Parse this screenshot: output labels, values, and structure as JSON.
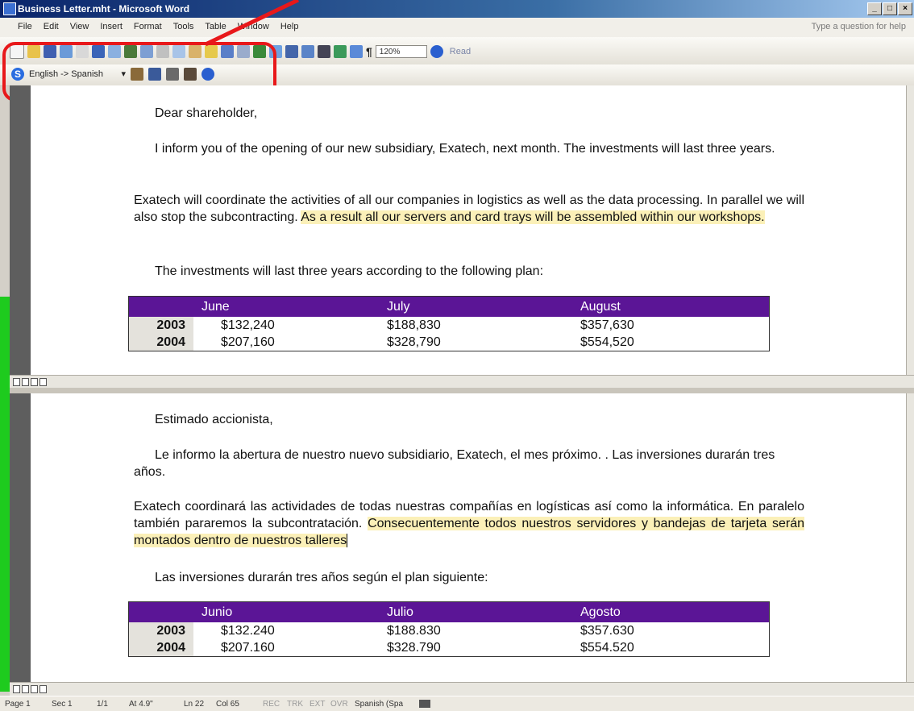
{
  "window": {
    "title": "Business Letter.mht - Microsoft Word"
  },
  "menu": {
    "items": [
      "File",
      "Edit",
      "View",
      "Insert",
      "Format",
      "Tools",
      "Table",
      "Window",
      "Help"
    ],
    "help_placeholder": "Type a question for help"
  },
  "toolbar": {
    "zoom": "120%",
    "read_label": "Read"
  },
  "translate_bar": {
    "direction": "English -> Spanish"
  },
  "english": {
    "greeting": "Dear shareholder,",
    "p1": "I inform you of the opening of our new subsidiary, Exatech, next month. The investments will last three years.",
    "p2_start": "Exatech will coordinate the activities of all our companies in logistics as well as the data processing. In parallel we will also stop the subcontracting. ",
    "p2_highlight": "As a result all our servers and card trays will be assembled within our workshops.",
    "p3": "The investments will last three years according to the following plan:",
    "table": {
      "headers": [
        "June",
        "July",
        "August"
      ],
      "rows": [
        {
          "year": "2003",
          "values": [
            "$132,240",
            "$188,830",
            "$357,630"
          ]
        },
        {
          "year": "2004",
          "values": [
            "$207,160",
            "$328,790",
            "$554,520"
          ]
        }
      ]
    }
  },
  "spanish": {
    "greeting": "Estimado accionista,",
    "p1": "Le informo la abertura de nuestro nuevo subsidiario, Exatech, el mes próximo. . Las inversiones durarán tres años.",
    "p2_start": "Exatech coordinará las actividades de todas nuestras compañías en logísticas así como la informática. En paralelo también pararemos la subcontratación. ",
    "p2_highlight": "Consecuentemente todos nuestros servidores y bandejas de tarjeta serán montados dentro de nuestros talleres",
    "p3": "Las inversiones durarán tres años según el plan siguiente:",
    "table": {
      "headers": [
        "Junio",
        "Julio",
        "Agosto"
      ],
      "rows": [
        {
          "year": "2003",
          "values": [
            "$132.240",
            "$188.830",
            "$357.630"
          ]
        },
        {
          "year": "2004",
          "values": [
            "$207.160",
            "$328.790",
            "$554.520"
          ]
        }
      ]
    }
  },
  "status": {
    "page": "Page 1",
    "sec": "Sec 1",
    "pages": "1/1",
    "at": "At 4.9\"",
    "ln": "Ln 22",
    "col": "Col 65",
    "rec": "REC",
    "trk": "TRK",
    "ext": "EXT",
    "ovr": "OVR",
    "language": "Spanish (Spa"
  },
  "colors": {
    "table_header": "#5b1596",
    "highlight": "#fbf0b8",
    "annotation": "#e8181a"
  }
}
